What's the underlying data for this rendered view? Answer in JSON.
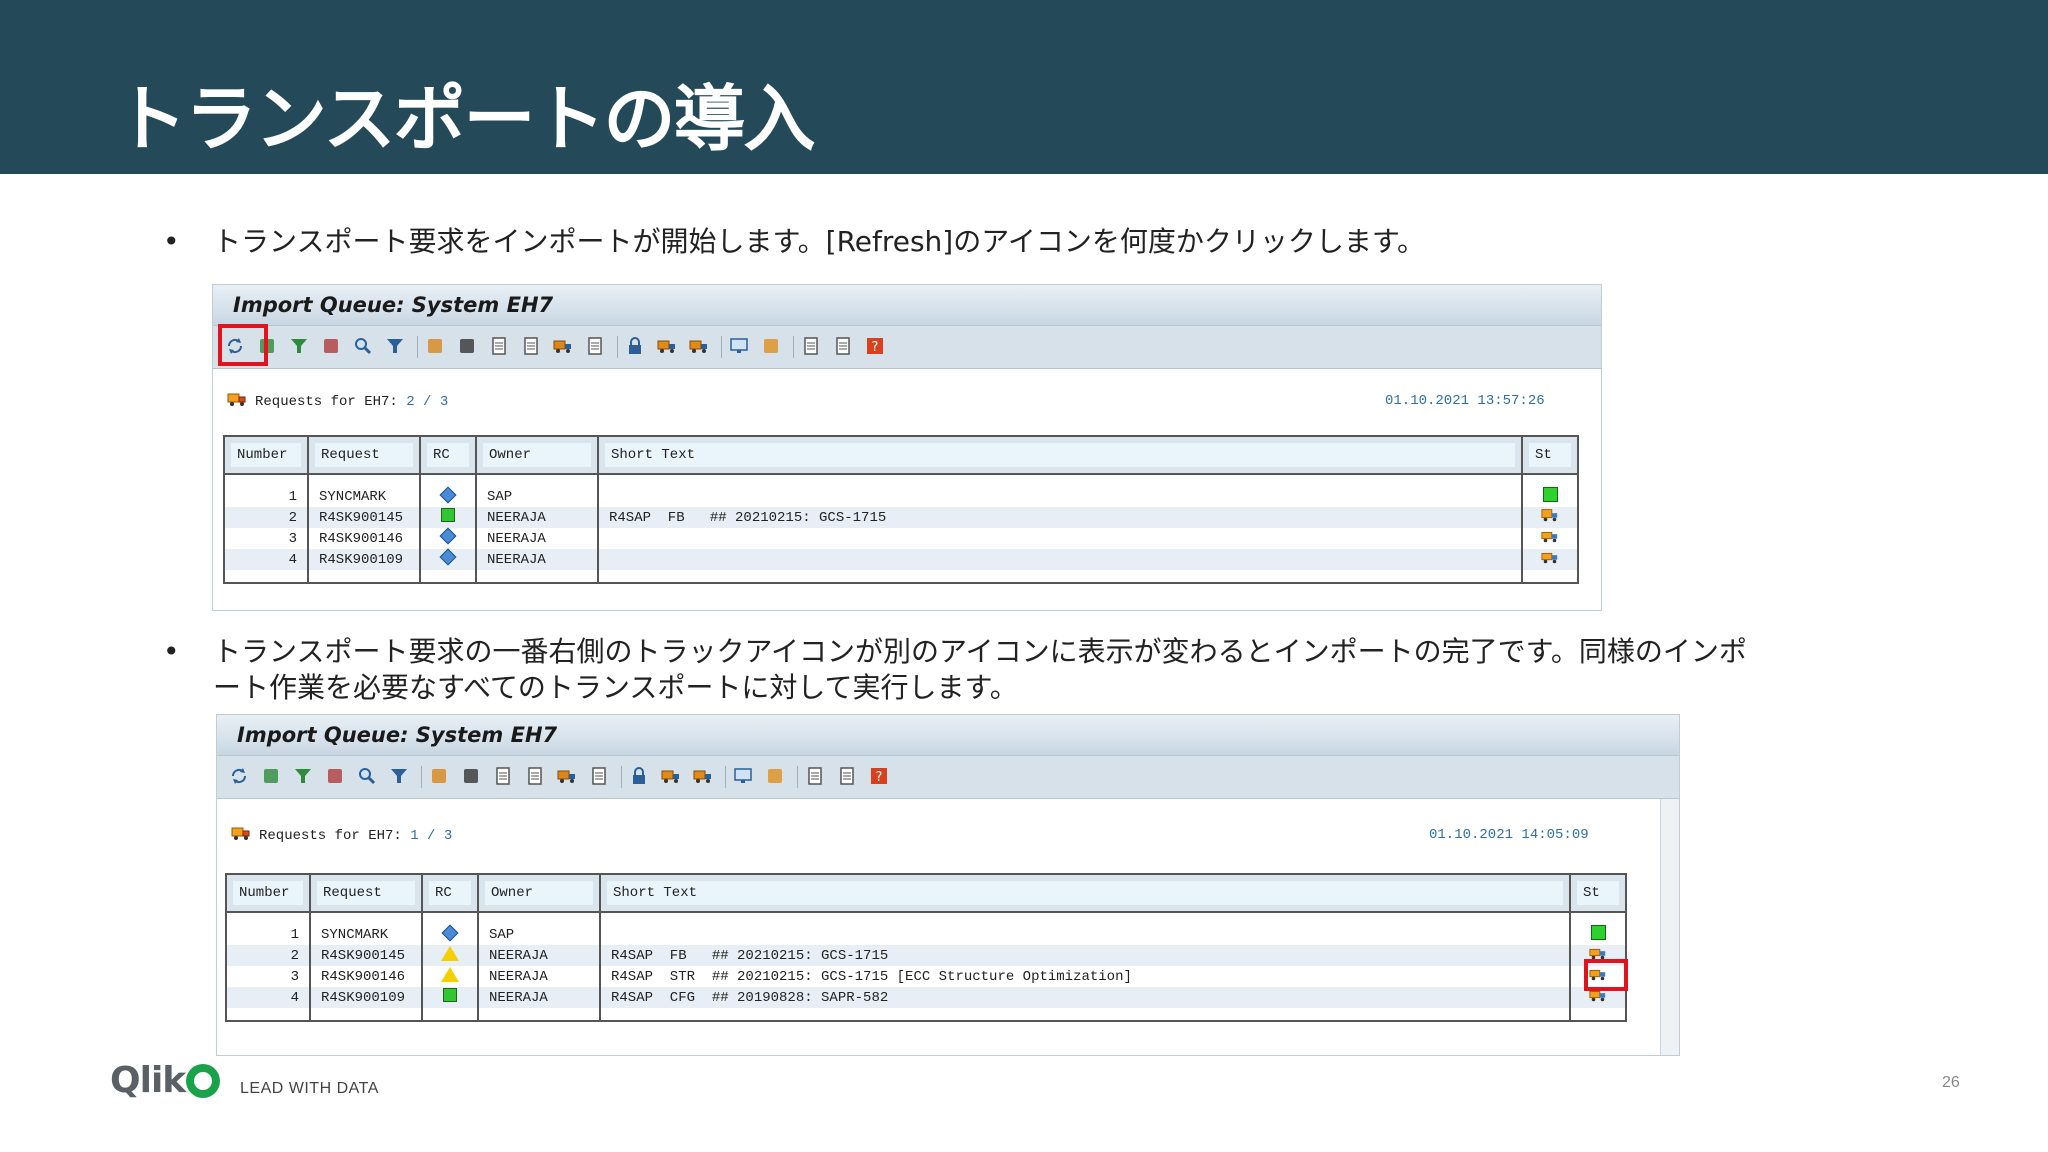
{
  "slide": {
    "title": "トランスポートの導入",
    "bullet1": "トランスポート要求をインポートが開始します。[Refresh]のアイコンを何度かクリックします。",
    "bullet2": "トランスポート要求の一番右側のトラックアイコンが別のアイコンに表示が変わるとインポートの完了です。同様のインポート作業を必要なすべてのトランスポートに対して実行します。",
    "bullet_glyph": "•",
    "page_number": "26"
  },
  "footer": {
    "logo": "Qlik",
    "tagline": "LEAD WITH DATA"
  },
  "screens": [
    {
      "title": "Import Queue: System EH7",
      "requests_label": "Requests for EH7:",
      "requests_count": "2 / 3",
      "timestamp": "01.10.2021 13:57:26",
      "columns": [
        "Number",
        "Request",
        "RC",
        "Owner",
        "Short Text",
        "St"
      ],
      "rows": [
        {
          "number": "1",
          "request": "SYNCMARK",
          "rc": "diamond",
          "owner": "SAP",
          "text": "",
          "st": "green"
        },
        {
          "number": "2",
          "request": "R4SK900145",
          "rc": "green",
          "owner": "NEERAJA",
          "text": "R4SAP  FB   ## 20210215: GCS-1715",
          "st": "truck"
        },
        {
          "number": "3",
          "request": "R4SK900146",
          "rc": "diamond",
          "owner": "NEERAJA",
          "text": "",
          "st": "truck-sm"
        },
        {
          "number": "4",
          "request": "R4SK900109",
          "rc": "diamond",
          "owner": "NEERAJA",
          "text": "",
          "st": "truck-sm"
        }
      ]
    },
    {
      "title": "Import Queue: System EH7",
      "requests_label": "Requests for EH7:",
      "requests_count": "1 / 3",
      "timestamp": "01.10.2021 14:05:09",
      "columns": [
        "Number",
        "Request",
        "RC",
        "Owner",
        "Short Text",
        "St"
      ],
      "rows": [
        {
          "number": "1",
          "request": "SYNCMARK",
          "rc": "diamond",
          "owner": "SAP",
          "text": "",
          "st": "green"
        },
        {
          "number": "2",
          "request": "R4SK900145",
          "rc": "warning",
          "owner": "NEERAJA",
          "text": "R4SAP  FB   ## 20210215: GCS-1715",
          "st": "truck-sm"
        },
        {
          "number": "3",
          "request": "R4SK900146",
          "rc": "warning",
          "owner": "NEERAJA",
          "text": "R4SAP  STR  ## 20210215: GCS-1715 [ECC Structure Optimization]",
          "st": "truck-sm"
        },
        {
          "number": "4",
          "request": "R4SK900109",
          "rc": "green",
          "owner": "NEERAJA",
          "text": "R4SAP  CFG  ## 20190828: SAPR-582",
          "st": "truck-sm"
        }
      ]
    }
  ],
  "toolbar_icons": [
    "refresh-icon",
    "stack-icon",
    "filter-down-icon",
    "select-icon",
    "search-icon",
    "funnel-icon",
    "transport-icon",
    "glasses-icon",
    "document-icon",
    "edit-document-icon",
    "truck-document-icon",
    "check-document-icon",
    "lock-icon",
    "truck-icon",
    "truck-move-icon",
    "monitor-icon",
    "tools-icon",
    "export-icon",
    "grid-icon",
    "help-icon"
  ],
  "colors": {
    "header": "#244a5a",
    "highlight": "#e0141e",
    "sap_bg": "#dfe8ef"
  }
}
